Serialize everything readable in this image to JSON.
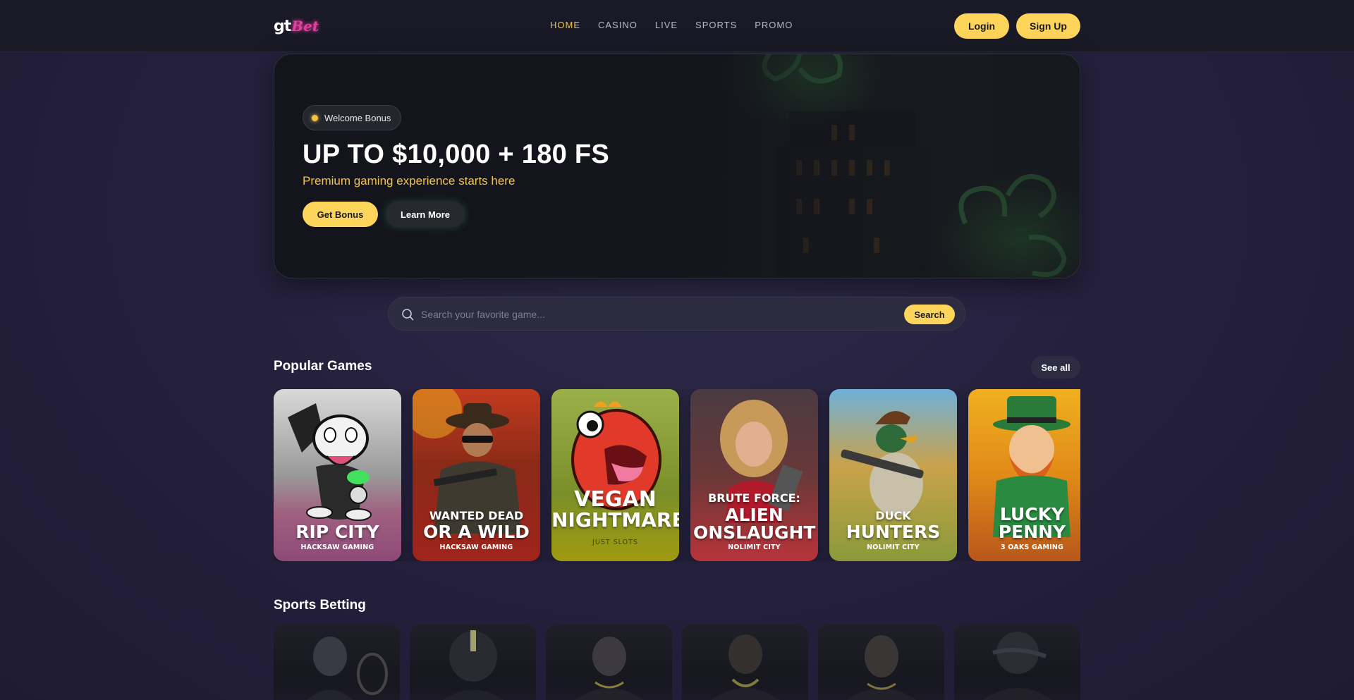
{
  "header": {
    "logo_gt": "gt",
    "logo_bet": "Bet",
    "nav": [
      {
        "label": "HOME",
        "active": true
      },
      {
        "label": "CASINO",
        "active": false
      },
      {
        "label": "LIVE",
        "active": false
      },
      {
        "label": "SPORTS",
        "active": false
      },
      {
        "label": "PROMO",
        "active": false
      }
    ],
    "login_label": "Login",
    "signup_label": "Sign Up"
  },
  "hero": {
    "badge": "Welcome Bonus",
    "title": "UP TO $10,000 + 180 FS",
    "subtitle": "Premium gaming experience starts here",
    "primary_cta": "Get Bonus",
    "secondary_cta": "Learn More"
  },
  "search": {
    "placeholder": "Search your favorite game...",
    "button_label": "Search"
  },
  "popular": {
    "title": "Popular Games",
    "see_all": "See all",
    "games": [
      {
        "pre": "",
        "title": "RIP CITY",
        "provider": "HACKSAW GAMING"
      },
      {
        "pre": "WANTED DEAD",
        "title": "OR A WILD",
        "provider": "HACKSAW GAMING"
      },
      {
        "pre": "VEGAN",
        "title": "NIGHTMARE",
        "provider": "JUST SLOTS"
      },
      {
        "pre": "BRUTE FORCE:",
        "title": "ALIEN ONSLAUGHT",
        "provider": "NOLIMIT CITY"
      },
      {
        "pre": "DUCK",
        "title": "HUNTERS",
        "provider": "NOLIMIT CITY"
      },
      {
        "pre": "LUCKY",
        "title": "PENNY",
        "provider": "3 OAKS GAMING"
      }
    ]
  },
  "sports": {
    "title": "Sports Betting"
  },
  "colors": {
    "accent": "#fdd55a",
    "nav_active": "#f5c247",
    "header_bg": "#1a1a26",
    "page_bg": "#25213d"
  }
}
